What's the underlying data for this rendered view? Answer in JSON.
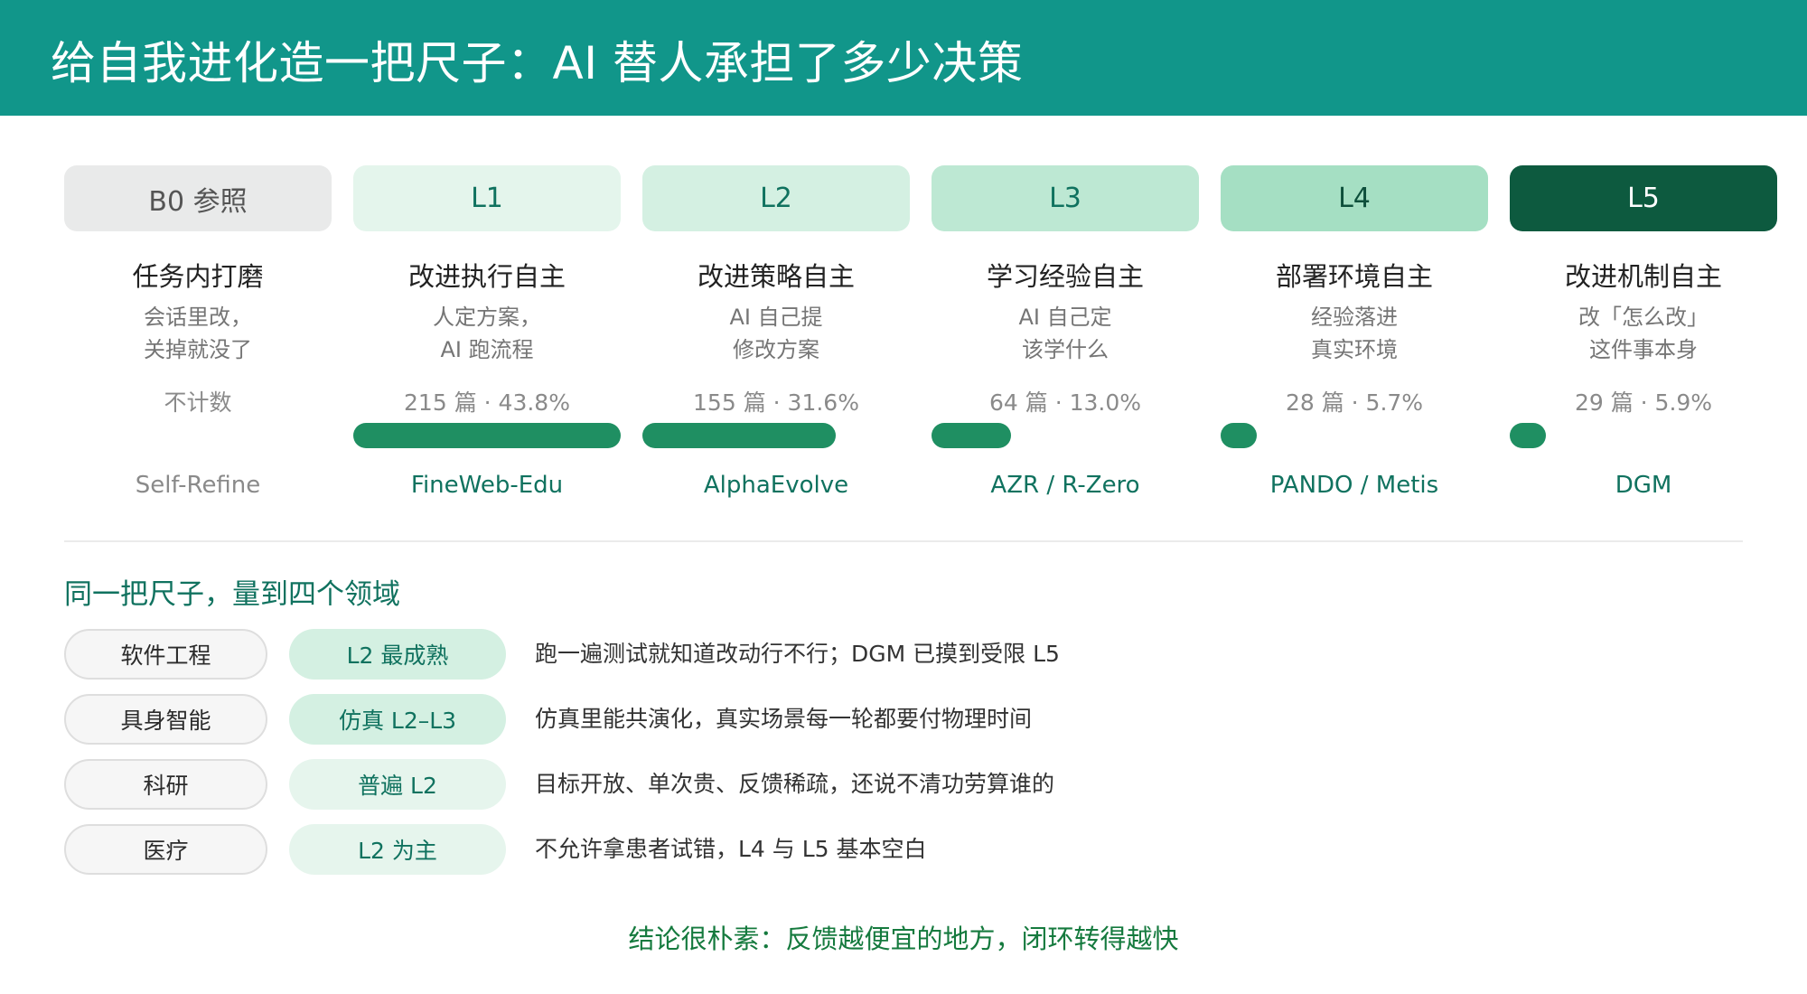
{
  "title": "给自我进化造一把尺子：AI 替人承担了多少决策",
  "levels": [
    {
      "code": "B0 参照",
      "name": "任务内打磨",
      "desc": [
        "会话里改，",
        "关掉就没了"
      ],
      "stat": "不计数",
      "share": null,
      "example": "Self-Refine",
      "pill_bg": "#e9eaea",
      "pill_fg": "#555555"
    },
    {
      "code": "L1",
      "name": "改进执行自主",
      "desc": [
        "人定方案，",
        "AI 跑流程"
      ],
      "stat": "215 篇 · 43.8%",
      "share": 43.8,
      "example": "FineWeb-Edu",
      "pill_bg": "#e4f5ec",
      "pill_fg": "#10725f"
    },
    {
      "code": "L2",
      "name": "改进策略自主",
      "desc": [
        "AI 自己提",
        "修改方案"
      ],
      "stat": "155 篇 · 31.6%",
      "share": 31.6,
      "example": "AlphaEvolve",
      "pill_bg": "#d4f0e2",
      "pill_fg": "#10725f"
    },
    {
      "code": "L3",
      "name": "学习经验自主",
      "desc": [
        "AI 自己定",
        "该学什么"
      ],
      "stat": "64 篇 · 13.0%",
      "share": 13.0,
      "example": "AZR / R-Zero",
      "pill_bg": "#bde8d3",
      "pill_fg": "#10725f"
    },
    {
      "code": "L4",
      "name": "部署环境自主",
      "desc": [
        "经验落进",
        "真实环境"
      ],
      "stat": "28 篇 · 5.7%",
      "share": 5.7,
      "example": "PANDO / Metis",
      "pill_bg": "#a5dfc3",
      "pill_fg": "#0d4f3b"
    },
    {
      "code": "L5",
      "name": "改进机制自主",
      "desc": [
        "改「怎么改」",
        "这件事本身"
      ],
      "stat": "29 篇 · 5.9%",
      "share": 5.9,
      "example": "DGM",
      "pill_bg": "#0d5a3f",
      "pill_fg": "#ffffff"
    }
  ],
  "section_title": "同一把尺子，量到四个领域",
  "domains": [
    {
      "name": "软件工程",
      "level": "L2 最成熟",
      "note": "跑一遍测试就知道改动行不行；DGM 已摸到受限 L5",
      "badge_bg": "#d4f0e2",
      "badge_fg": "#10725f"
    },
    {
      "name": "具身智能",
      "level": "仿真 L2–L3",
      "note": "仿真里能共演化，真实场景每一轮都要付物理时间",
      "badge_bg": "#d4f0e2",
      "badge_fg": "#10725f"
    },
    {
      "name": "科研",
      "level": "普遍 L2",
      "note": "目标开放、单次贵、反馈稀疏，还说不清功劳算谁的",
      "badge_bg": "#e6f5ed",
      "badge_fg": "#10725f"
    },
    {
      "name": "医疗",
      "level": "L2 为主",
      "note": "不允许拿患者试错，L4 与 L5 基本空白",
      "badge_bg": "#e6f5ed",
      "badge_fg": "#10725f"
    }
  ],
  "conclusion": "结论很朴素：反馈越便宜的地方，闭环转得越快"
}
